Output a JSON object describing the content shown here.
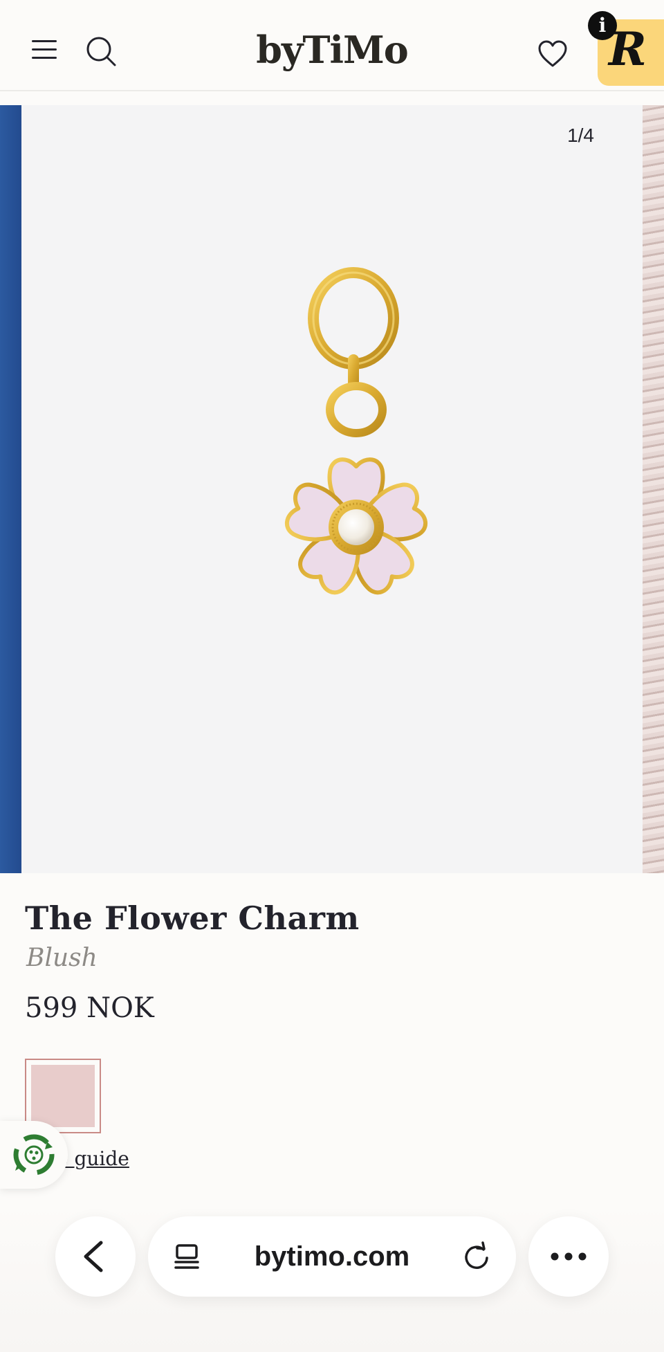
{
  "header": {
    "logo": "byTiMo",
    "badge_letter": "R",
    "info_badge": "i"
  },
  "gallery": {
    "counter": "1/4"
  },
  "product": {
    "name": "The Flower Charm",
    "variant": "Blush",
    "price": "599 NOK",
    "swatch_color": "#e8cccb",
    "size_guide_label": "e guide"
  },
  "browser": {
    "url": "bytimo.com"
  },
  "icons": {
    "menu": "hamburger-menu-icon",
    "search": "search-icon",
    "wishlist": "heart-icon",
    "eco": "recycle-icon",
    "back": "chevron-left-icon",
    "tabs": "tabs-icon",
    "reload": "reload-icon",
    "more": "more-dots-icon"
  },
  "colors": {
    "background": "#fcfbf9",
    "text": "#23232c",
    "badge": "#fbd67a",
    "charm_gold": "#e0b23b",
    "charm_petal": "#ecdbe8",
    "eco_green": "#2e7d32"
  }
}
